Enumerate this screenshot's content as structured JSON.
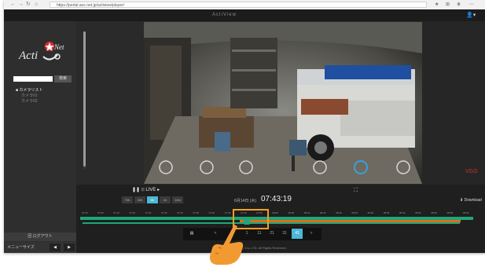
{
  "browser": {
    "url": "https://portal.aoc.net.jp/actiview/player/",
    "nav_icons": [
      "back-icon",
      "forward-icon",
      "reload-icon",
      "home-icon"
    ],
    "toolbar_icons": [
      "star-icon",
      "bookmark-icon",
      "extension-icon",
      "menu-icon"
    ]
  },
  "app": {
    "header_title": "ActiView",
    "user_icon": "user-icon"
  },
  "logo": {
    "text_top": "Net",
    "text_main": "Acti"
  },
  "sidebar": {
    "search_button": "検索",
    "camera_list_title": "■ カメラリスト",
    "camera_items": [
      "カメラ01",
      "カメラ02"
    ],
    "logout_label": "⊠ ログアウト",
    "menu_size_label": "メニューサイズ",
    "menu_prev": "◀",
    "menu_next": "▶"
  },
  "player": {
    "live_label": "❚❚ ⦙⦙⦙ LIVE ▸",
    "speeds": [
      "72h",
      "24h",
      "6h",
      "1h",
      "10m"
    ],
    "active_speed": "6h",
    "date_label": "6月14日 (木)",
    "time": "07:43:19",
    "download_label": "⬇ Download",
    "vid_badge": "VGO"
  },
  "timeline": {
    "ticks": [
      "07:00",
      "07:05",
      "07:10",
      "07:15",
      "07:20",
      "07:25",
      "07:30",
      "07:35",
      "07:40",
      "07:45",
      "07:50",
      "07:55",
      "08:00",
      "08:05",
      "08:10",
      "08:15",
      "08:20",
      "08:25",
      "08:30",
      "08:35",
      "08:40",
      "08:45",
      "08:50",
      "08:55",
      "09:00"
    ]
  },
  "pagination": {
    "first_icon": "grid-icon",
    "prev": "<",
    "pages": [
      "1",
      "11",
      "21",
      "31",
      "41"
    ],
    "active_page": "41",
    "next": ">"
  },
  "footer": {
    "copyright": "Copyright © 2018 AOC Co.,LTD. All Rights Reserved."
  },
  "colors": {
    "accent": "#4bb8d6",
    "timeline": "#1ea77a",
    "timeline_orange": "#e06a1a",
    "highlight": "#f0a020",
    "hand": "#f29a32"
  }
}
